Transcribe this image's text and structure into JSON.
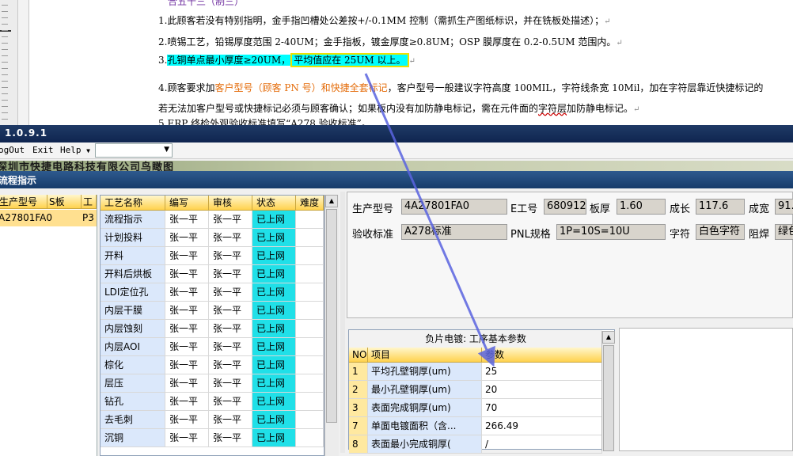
{
  "document": {
    "top_fragment": "合五十三（制三）",
    "line1": "1.此顾客若没有特别指明，金手指凹槽处公差按+/-0.1MM 控制（需抓生产图纸标识，并在铣板处描述）；",
    "line2": "2.喷锡工艺，铅锡厚度范围 2-40UM；金手指板，镀金厚度≥0.8UM；OSP 膜厚度在 0.2-0.5UM 范围内。",
    "line3_prefix": "3.",
    "line3_highlight": "孔铜单点最小厚度≥20UM，",
    "line3_boxed": "平均值应在 25UM 以上。",
    "line4_a": "4.顾客要求加",
    "line4_orange": "客户型号（顾客 PN 号）和快捷全套标记",
    "line4_b": "，客户型号一般建议字符高度 100MIL，字符线条宽 10Mil，加在字符层靠近快捷标记的",
    "line5_a": "若无法加客户型号或快捷标记必须与顾客确认；如果板内没有加防静电标记，需在元件面的",
    "line5_spell": "字符层",
    "line5_b": "加防静电标记。",
    "line6": "5.ERP 终检外观验收标准填写“A278 验收标准”。",
    "para_mark": "↵"
  },
  "app": {
    "title": "1.0.9.1",
    "menu": {
      "logout": "ogOut",
      "exit": "Exit",
      "help": "Help"
    },
    "banner": "深圳市快捷电路科技有限公司鸟瞰图",
    "panel_title": "流程指示"
  },
  "left_table": {
    "headers": [
      "生产型号",
      "S板",
      "工"
    ],
    "row": [
      "A27801FA0",
      "",
      "P3"
    ]
  },
  "process_list": {
    "headers": [
      "工艺名称",
      "编写",
      "审核",
      "状态",
      "难度"
    ],
    "rows": [
      [
        "流程指示",
        "张一平",
        "张一平",
        "已上网",
        ""
      ],
      [
        "计划投料",
        "张一平",
        "张一平",
        "已上网",
        ""
      ],
      [
        "开料",
        "张一平",
        "张一平",
        "已上网",
        ""
      ],
      [
        "开料后烘板",
        "张一平",
        "张一平",
        "已上网",
        ""
      ],
      [
        "LDI定位孔",
        "张一平",
        "张一平",
        "已上网",
        ""
      ],
      [
        "内层干膜",
        "张一平",
        "张一平",
        "已上网",
        ""
      ],
      [
        "内层蚀刻",
        "张一平",
        "张一平",
        "已上网",
        ""
      ],
      [
        "内层AOI",
        "张一平",
        "张一平",
        "已上网",
        ""
      ],
      [
        "棕化",
        "张一平",
        "张一平",
        "已上网",
        ""
      ],
      [
        "层压",
        "张一平",
        "张一平",
        "已上网",
        ""
      ],
      [
        "钻孔",
        "张一平",
        "张一平",
        "已上网",
        ""
      ],
      [
        "去毛刺",
        "张一平",
        "张一平",
        "已上网",
        ""
      ],
      [
        "沉铜",
        "张一平",
        "张一平",
        "已上网",
        ""
      ]
    ]
  },
  "info": {
    "model_label": "生产型号",
    "model_value": "4A27801FA0",
    "eno_label": "E工号",
    "eno_value": "680912",
    "thickness_label": "板厚",
    "thickness_value": "1.60",
    "length_label": "成长",
    "length_value": "117.6",
    "width_label": "成宽",
    "width_value": "91.",
    "standard_label": "验收标准",
    "standard_value": "A278标准",
    "pnl_label": "PNL规格",
    "pnl_value": "1P=10S=10U",
    "char_label": "字符",
    "char_value": "白色字符",
    "mask_label": "阻焊",
    "mask_value": "绿色"
  },
  "params": {
    "title": "负片电镀: 工序基本参数",
    "headers": [
      "NO",
      "项目",
      "参数"
    ],
    "rows": [
      [
        "1",
        "平均孔壁铜厚(um)",
        "25"
      ],
      [
        "2",
        "最小孔壁铜厚(um)",
        "20"
      ],
      [
        "3",
        "表面完成铜厚(um)",
        "70"
      ],
      [
        "7",
        "单面电镀面积（含...",
        "266.49"
      ],
      [
        "8",
        "表面最小完成铜厚(",
        "/"
      ]
    ]
  },
  "colors": {
    "arrow": "#5a64e0",
    "status_cell": "#20e0e8",
    "header_gold": "#ffd24d",
    "title_blue": "#163b6a"
  }
}
